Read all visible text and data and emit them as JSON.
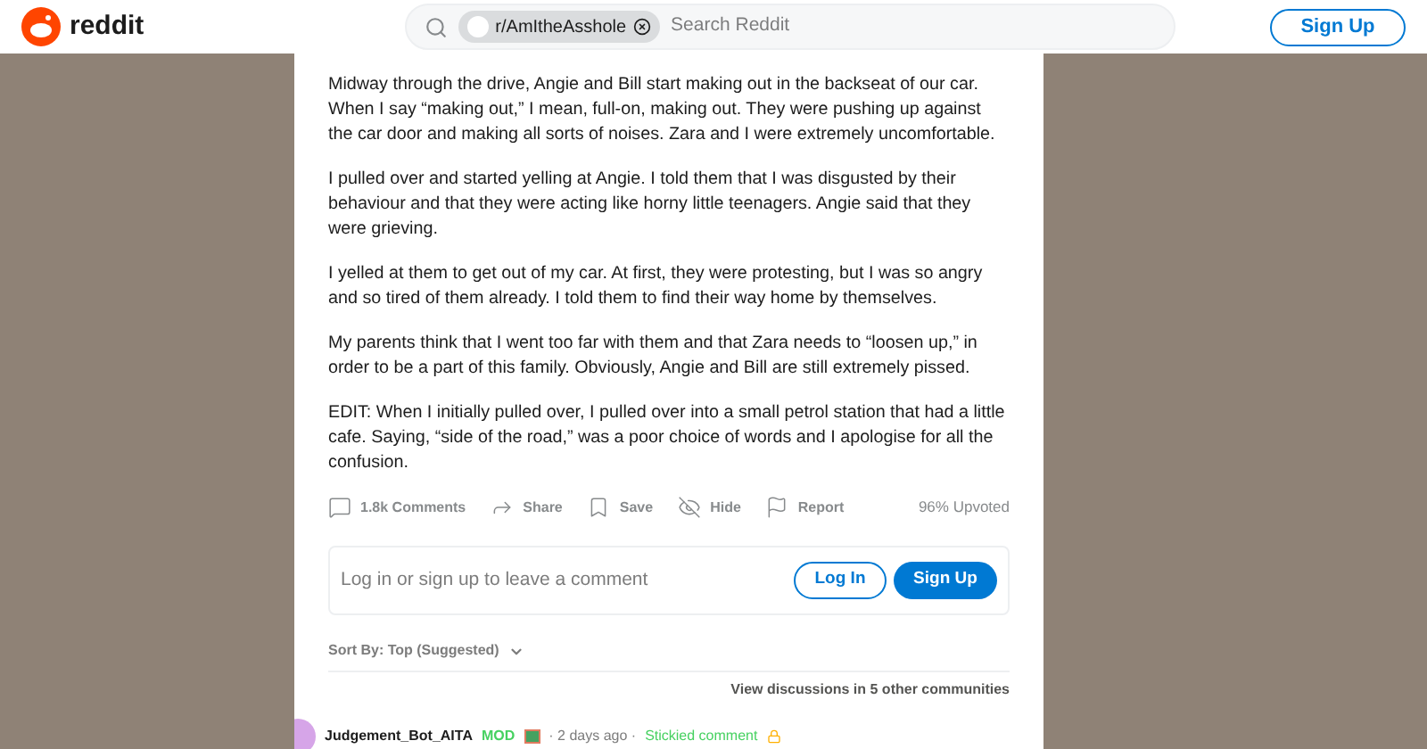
{
  "header": {
    "logo": "reddit",
    "search_chip": "r/AmItheAsshole",
    "search_placeholder": "Search Reddit",
    "signup": "Sign Up"
  },
  "paragraphs": [
    "Midway through the drive, Angie and Bill start making out in the backseat of our car. When I say “making out,” I mean, full-on, making out. They were pushing up against the car door and making all sorts of noises. Zara and I were extremely uncomfortable.",
    "I pulled over and started yelling at Angie. I told them that I was disgusted by their behaviour and that they were acting like horny little teenagers. Angie said that they were grieving.",
    "I yelled at them to get out of my car. At first, they were protesting, but I was so angry and so tired of them already. I told them to find their way home by themselves.",
    "My parents think that I went too far with them and that Zara needs to “loosen up,” in order to be a part of this family. Obviously, Angie and Bill are still extremely pissed.",
    "EDIT: When I initially pulled over, I pulled over into a small petrol station that had a little cafe. Saying, “side of the road,” was a poor choice of words and I apologise for all the confusion."
  ],
  "actions": [
    {
      "kind": "comments",
      "label": "1.8k Comments"
    },
    {
      "kind": "share",
      "label": "Share"
    },
    {
      "kind": "save",
      "label": "Save"
    },
    {
      "kind": "hide",
      "label": "Hide"
    },
    {
      "kind": "report",
      "label": "Report"
    }
  ],
  "upvoted": "96% Upvoted",
  "comment_box": {
    "prompt": "Log in or sign up to leave a comment",
    "login": "Log In",
    "signup": "Sign Up"
  },
  "sort": "Sort By: Top (Suggested)",
  "other_discussions": "View discussions in 5 other communities",
  "comment": {
    "author": "Judgement_Bot_AITA",
    "badge": "MOD",
    "time": "· 2 days ago ·",
    "stickied": "Stickied comment"
  }
}
